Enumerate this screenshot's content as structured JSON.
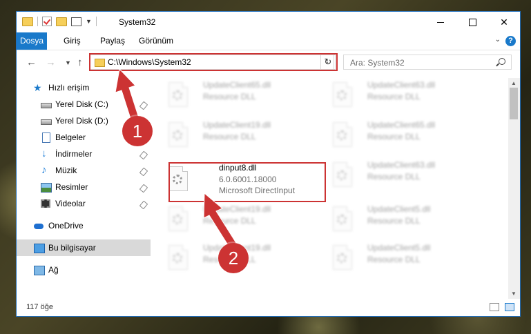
{
  "window": {
    "title": "System32"
  },
  "ribbon": {
    "tabs": [
      "Dosya",
      "Giriş",
      "Paylaş",
      "Görünüm"
    ],
    "help": "?"
  },
  "nav": {
    "address": "C:\\Windows\\System32",
    "search_placeholder": "Ara: System32"
  },
  "sidebar": {
    "items": [
      {
        "label": "Hızlı erişim",
        "icon": "star-icon"
      },
      {
        "label": "Yerel Disk (C:)",
        "icon": "drive-icon",
        "pinned": true
      },
      {
        "label": "Yerel Disk (D:)",
        "icon": "drive-icon",
        "pinned": true
      },
      {
        "label": "Belgeler",
        "icon": "documents-icon",
        "pinned": true
      },
      {
        "label": "İndirmeler",
        "icon": "download-icon",
        "pinned": true
      },
      {
        "label": "Müzik",
        "icon": "music-icon",
        "pinned": true
      },
      {
        "label": "Resimler",
        "icon": "pictures-icon",
        "pinned": true
      },
      {
        "label": "Videolar",
        "icon": "videos-icon",
        "pinned": true
      },
      {
        "label": "OneDrive",
        "icon": "cloud-icon"
      },
      {
        "label": "Bu bilgisayar",
        "icon": "computer-icon",
        "selected": true
      },
      {
        "label": "Ağ",
        "icon": "network-icon"
      }
    ]
  },
  "files": [
    {
      "name": "UpdateClient65.dll",
      "type": "Resource DLL"
    },
    {
      "name": "UpdateClient63.dll",
      "type": "Resource DLL"
    },
    {
      "name": "UpdateClient19.dll",
      "type": "Resource DLL"
    },
    {
      "name": "UpdateClient65.dll",
      "type": "Resource DLL"
    },
    {
      "name": "dinput8.dll",
      "version": "6.0.6001.18000",
      "description": "Microsoft DirectInput"
    },
    {
      "name": "UpdateClient63.dll",
      "type": "Resource DLL"
    },
    {
      "name": "UpdateClient19.dll",
      "type": "Resource DLL"
    },
    {
      "name": "UpdateClient5.dll",
      "type": "Resource DLL"
    },
    {
      "name": "UpdateClient19.dll",
      "type": "Resource DLL"
    },
    {
      "name": "UpdateClient5.dll",
      "type": "Resource DLL"
    }
  ],
  "status": {
    "item_count": "117 öğe"
  },
  "annotations": {
    "step1": "1",
    "step2": "2",
    "color": "#cc3333"
  }
}
